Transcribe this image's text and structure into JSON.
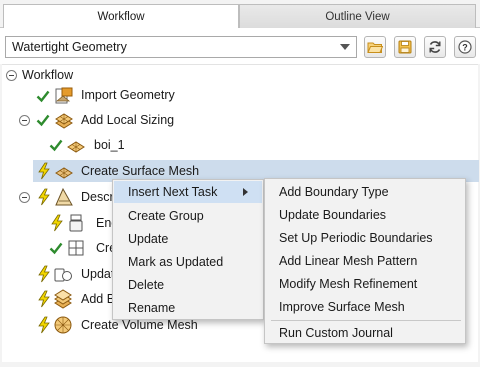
{
  "tabs": {
    "workflow": "Workflow",
    "outline": "Outline View"
  },
  "toolbar": {
    "workflow_select": "Watertight Geometry",
    "buttons": [
      "open-folder-icon",
      "save-icon",
      "refresh-icon",
      "help-icon"
    ]
  },
  "tree": {
    "root": "Workflow",
    "items": [
      {
        "label": "Import Geometry",
        "status": "done"
      },
      {
        "label": "Add Local Sizing",
        "status": "done"
      },
      {
        "label": "boi_1",
        "status": "done"
      },
      {
        "label": "Create Surface Mesh",
        "status": "pending"
      },
      {
        "label": "Descr",
        "status": "pending"
      },
      {
        "label": "Enc",
        "status": "pending"
      },
      {
        "label": "Cre",
        "status": "pending"
      },
      {
        "label": "Updat",
        "status": "pending"
      },
      {
        "label": "Add B",
        "status": "pending"
      },
      {
        "label": "Create Volume Mesh",
        "status": "pending"
      }
    ]
  },
  "context_menu": {
    "items": [
      "Insert Next Task",
      "Create Group",
      "Update",
      "Mark as Updated",
      "Delete",
      "Rename"
    ]
  },
  "submenu": {
    "items": [
      "Add Boundary Type",
      "Update Boundaries",
      "Set Up Periodic Boundaries",
      "Add Linear Mesh Pattern",
      "Modify Mesh Refinement",
      "Improve Surface Mesh"
    ],
    "journal": "Run Custom Journal"
  },
  "colors": {
    "check": "#2e8b2e",
    "bolt": "#f2d600",
    "selection": "#cddcec",
    "menu_highlight": "#cfe0f3"
  }
}
